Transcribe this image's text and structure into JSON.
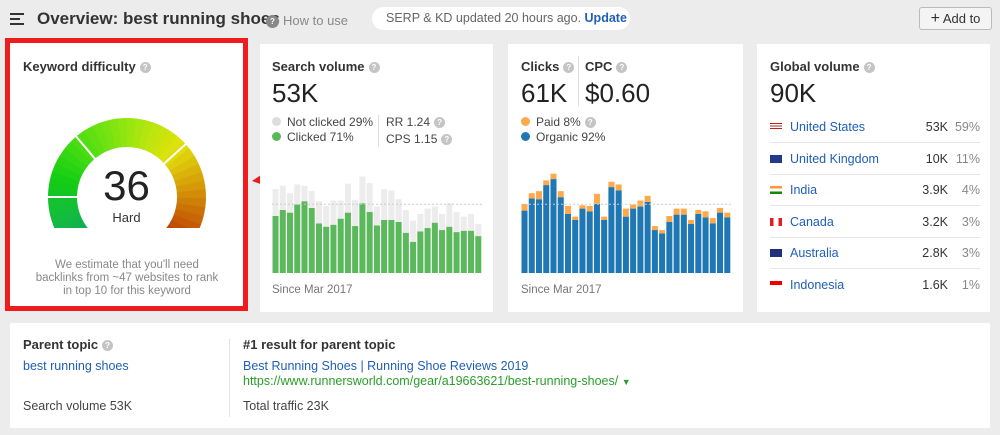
{
  "header": {
    "title": "Overview: best running shoes",
    "how_to_use": "How to use",
    "serp_status": "SERP & KD updated 20 hours ago.",
    "update_label": "Update",
    "add_to_label": "Add to"
  },
  "kd": {
    "title": "Keyword difficulty",
    "value": "36",
    "level": "Hard",
    "note": "We estimate that you'll need backlinks from ~47 websites to rank in top 10 for this keyword",
    "score": 36
  },
  "search_volume": {
    "title": "Search volume",
    "value": "53K",
    "not_clicked": "Not clicked 29%",
    "clicked": "Clicked 71%",
    "rr": "RR 1.24",
    "cps": "CPS 1.15",
    "since": "Since Mar 2017"
  },
  "clicks": {
    "title": "Clicks",
    "value": "61K",
    "cpc_title": "CPC",
    "cpc_value": "$0.60",
    "paid": "Paid 8%",
    "organic": "Organic 92%",
    "since": "Since Mar 2017"
  },
  "global_volume": {
    "title": "Global volume",
    "value": "90K",
    "countries": [
      {
        "name": "United States",
        "volume": "53K",
        "share": "59%",
        "flag": "us-flag"
      },
      {
        "name": "United Kingdom",
        "volume": "10K",
        "share": "11%",
        "flag": "uk-flag"
      },
      {
        "name": "India",
        "volume": "3.9K",
        "share": "4%",
        "flag": "india-flag"
      },
      {
        "name": "Canada",
        "volume": "3.2K",
        "share": "3%",
        "flag": "canada-flag"
      },
      {
        "name": "Australia",
        "volume": "2.8K",
        "share": "3%",
        "flag": "australia-flag"
      },
      {
        "name": "Indonesia",
        "volume": "1.6K",
        "share": "1%",
        "flag": "indonesia-flag"
      }
    ]
  },
  "parent": {
    "title": "Parent topic",
    "topic": "best running shoes",
    "search_volume": "Search volume 53K",
    "result_title": "#1 result for parent topic",
    "result_link": "Best Running Shoes | Running Shoe Reviews 2019",
    "result_url": "https://www.runnersworld.com/gear/a19663621/best-running-shoes/",
    "total_traffic": "Total traffic 23K"
  },
  "colors": {
    "clicked": "#5cb85c",
    "not_clicked": "#e3e3e3",
    "paid": "#ffa94d",
    "organic": "#1f77b4",
    "highlight": "#ee1c1c",
    "link": "#1f5fb8",
    "url": "#2a9d2a"
  },
  "chart_data": [
    {
      "type": "bar",
      "stacked": true,
      "series": [
        {
          "name": "Clicked",
          "values": [
            170,
            188,
            180,
            204,
            214,
            194,
            148,
            138,
            144,
            162,
            180,
            140,
            208,
            182,
            142,
            158,
            158,
            152,
            120,
            93,
            124,
            134,
            150,
            128,
            138,
            122,
            126,
            126,
            110
          ]
        },
        {
          "name": "Not clicked",
          "values": [
            80,
            72,
            58,
            60,
            46,
            50,
            66,
            62,
            72,
            54,
            86,
            78,
            80,
            86,
            56,
            92,
            88,
            68,
            68,
            63,
            52,
            58,
            48,
            48,
            70,
            60,
            42,
            50,
            36
          ]
        }
      ],
      "xlabel": "Since Mar 2017"
    },
    {
      "type": "bar",
      "stacked": true,
      "series": [
        {
          "name": "Organic",
          "values": [
            186,
            222,
            220,
            262,
            280,
            226,
            176,
            158,
            192,
            184,
            206,
            158,
            256,
            246,
            168,
            192,
            198,
            212,
            128,
            118,
            152,
            174,
            174,
            146,
            176,
            166,
            148,
            180,
            166
          ]
        },
        {
          "name": "Paid",
          "values": [
            20,
            16,
            24,
            14,
            16,
            18,
            24,
            10,
            10,
            16,
            30,
            10,
            16,
            18,
            24,
            12,
            18,
            18,
            12,
            10,
            18,
            18,
            18,
            12,
            12,
            18,
            16,
            14,
            14
          ]
        }
      ],
      "xlabel": "Since Mar 2017"
    }
  ]
}
